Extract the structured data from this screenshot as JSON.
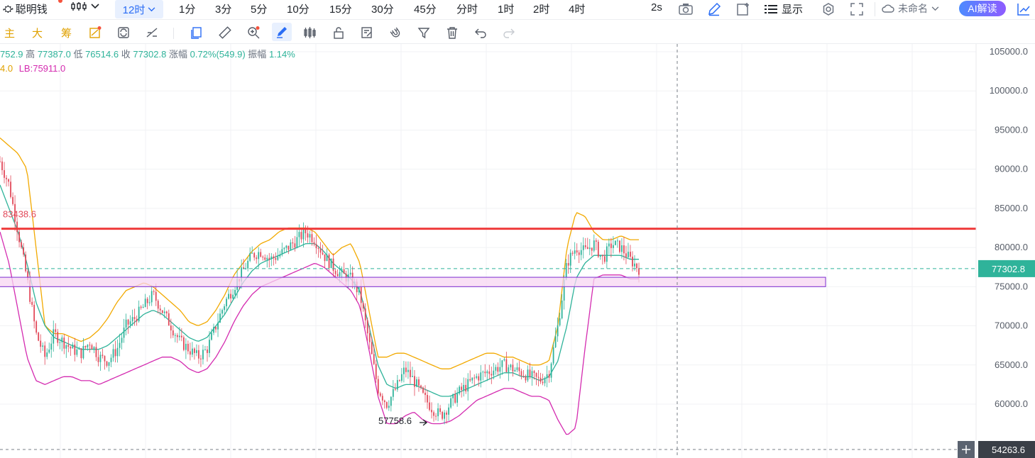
{
  "header": {
    "brand": "聪明钱",
    "timeframe_active": "12时",
    "timeframes": [
      "1分",
      "3分",
      "5分",
      "10分",
      "15分",
      "30分",
      "45分",
      "分时",
      "1时",
      "2时",
      "4时"
    ],
    "refresh": "2s",
    "display_label": "显示",
    "layout_name": "未命名",
    "ai_label": "AI解读"
  },
  "toolbar": {
    "labels": [
      "主",
      "大",
      "筹"
    ]
  },
  "ohlc": {
    "open_partial": "752.9",
    "high_label": "高",
    "high": "77387.0",
    "low_label": "低",
    "low": "76514.6",
    "close_label": "收",
    "close": "77302.8",
    "change_label": "涨幅",
    "change": "0.72%(549.9)",
    "amp_label": "振幅",
    "amp": "1.14%"
  },
  "bands": {
    "ub_partial": "4.0",
    "lb_text": "LB:75911.0"
  },
  "chart_data": {
    "type": "candlestick",
    "colors": {
      "up": "#2fb39a",
      "down": "#e2495a",
      "upper_band": "#f2a900",
      "middle_band": "#2fb39a",
      "lower_band": "#d42bb0",
      "resistance": "#ef3b3b",
      "zone_fill": "#f7d6f2",
      "zone_border": "#7b2bd0",
      "current_price": "#2fb39a"
    },
    "y_ticks": [
      "105000.0",
      "100000.0",
      "95000.0",
      "90000.0",
      "85000.0",
      "80000.0",
      "75000.0",
      "70000.0",
      "65000.0",
      "60000.0"
    ],
    "ylim": [
      54263.6,
      105000
    ],
    "current_price": "77302.8",
    "crosshair_price": "54263.6",
    "resistance_level": 82400,
    "resistance_label": "83438.6",
    "zone": [
      75000,
      76200
    ],
    "low_marker": "57758.6",
    "price_path": [
      91000,
      88000,
      82000,
      76000,
      69000,
      66000,
      69000,
      68000,
      67000,
      66500,
      68000,
      66000,
      65500,
      67000,
      70000,
      71000,
      72500,
      74000,
      72000,
      70000,
      68000,
      67000,
      66000,
      67000,
      70000,
      73000,
      75000,
      77000,
      79000,
      79500,
      78500,
      79000,
      80000,
      81000,
      82000,
      81000,
      79000,
      77500,
      76500,
      76000,
      74000,
      68000,
      62000,
      60000,
      62000,
      64500,
      63000,
      61000,
      59500,
      58500,
      60000,
      61500,
      62500,
      63500,
      64000,
      64500,
      65000,
      64500,
      64000,
      63500,
      63000,
      64000,
      70000,
      78000,
      80000,
      79500,
      80500,
      78500,
      80500,
      80000,
      78500,
      77300
    ],
    "upper_band": [
      94000,
      93000,
      92000,
      90000,
      80000,
      70000,
      69000,
      69000,
      68500,
      68000,
      68500,
      69500,
      71000,
      73000,
      74500,
      75000,
      75500,
      75000,
      74000,
      73000,
      72000,
      70500,
      70000,
      70500,
      72000,
      74000,
      76500,
      78000,
      79500,
      80500,
      81000,
      82000,
      82500,
      82500,
      82500,
      82000,
      80500,
      79000,
      80000,
      80500,
      78000,
      72000,
      66000,
      66000,
      66500,
      66500,
      66000,
      65500,
      65000,
      64500,
      64500,
      65000,
      65500,
      66000,
      66500,
      66500,
      66000,
      66000,
      65500,
      65000,
      65000,
      65500,
      70000,
      80000,
      84500,
      84000,
      82000,
      81000,
      81000,
      81500,
      81000,
      81000
    ],
    "middle_band": [
      88000,
      85000,
      82000,
      78000,
      73000,
      70000,
      68500,
      68000,
      67500,
      67000,
      67000,
      67000,
      67500,
      68500,
      69500,
      70500,
      71500,
      72000,
      71500,
      70500,
      69500,
      68500,
      68000,
      68500,
      70000,
      71500,
      73500,
      75500,
      77000,
      78000,
      78500,
      79000,
      79500,
      80000,
      80500,
      80500,
      79500,
      78000,
      77000,
      76000,
      74500,
      70000,
      65000,
      62500,
      62000,
      62500,
      62500,
      62000,
      61500,
      61000,
      61000,
      61500,
      62000,
      62500,
      63000,
      63500,
      64000,
      64000,
      63500,
      63500,
      63000,
      63500,
      65500,
      70000,
      76000,
      78000,
      79000,
      79000,
      79000,
      79000,
      78500,
      78500
    ],
    "lower_band": [
      82000,
      78000,
      72000,
      66000,
      63000,
      62500,
      63000,
      63500,
      63500,
      63000,
      63000,
      62500,
      63000,
      63500,
      64000,
      64500,
      65000,
      65500,
      66000,
      66000,
      65500,
      64500,
      64000,
      64500,
      66000,
      68000,
      70500,
      72500,
      74000,
      75000,
      75500,
      76000,
      76500,
      77000,
      77500,
      78000,
      77500,
      76500,
      75500,
      74500,
      72500,
      67000,
      61000,
      57500,
      57500,
      58500,
      59000,
      58000,
      57500,
      57500,
      57800,
      58500,
      59500,
      60500,
      61000,
      61500,
      62000,
      62000,
      61500,
      61000,
      61000,
      60500,
      58000,
      56000,
      57000,
      67000,
      76000,
      76500,
      76500,
      76500,
      76000,
      76000
    ]
  }
}
